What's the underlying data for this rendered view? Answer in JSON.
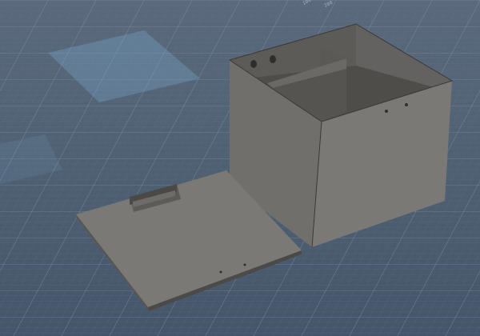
{
  "viewport": {
    "view": "perspective",
    "background_color": "#4d5d70",
    "grid_color": "#7f93aa",
    "selection_highlight_color": "#6f9fc4"
  },
  "rulers": {
    "left_label": "100",
    "right_label": "200"
  },
  "model": {
    "box_wall_color": "#6f6e6a",
    "box_shadow_color": "#4a4946",
    "lid_color": "#6c6b68",
    "icons": [
      "box-body-icon",
      "lid-icon",
      "handle-icon"
    ]
  }
}
